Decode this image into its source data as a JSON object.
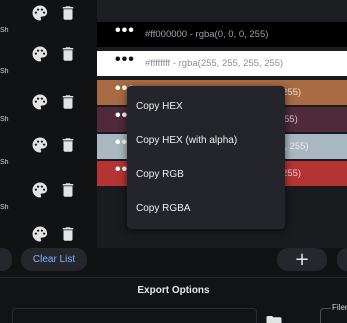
{
  "left_list": {
    "row_label": "Sh",
    "rows": 6
  },
  "buttons": {
    "clear_list": "Clear List",
    "add": "+"
  },
  "swatches": [
    {
      "color": "#000000",
      "text_color": "#9aa0a6",
      "dots_color": "#ffffff",
      "text": "#ff000000 - rgba(0, 0, 0, 255)"
    },
    {
      "color": "#ffffff",
      "text_color": "#8a8f96",
      "dots_color": "#111111",
      "text": "#ffffffff - rgba(255, 255, 255, 255)"
    },
    {
      "color": "#a86b43",
      "text_color": "#f2d9c6",
      "dots_color": "#ffffff",
      "text": "255)"
    },
    {
      "color": "#4e2a3a",
      "text_color": "#d9c4cc",
      "dots_color": "#ffffff",
      "text": "55)"
    },
    {
      "color": "#a9b8c0",
      "text_color": "#e8eef1",
      "dots_color": "#ffffff",
      "text": "3, 255)"
    },
    {
      "color": "#b43434",
      "text_color": "#f4c9c9",
      "dots_color": "#ffffff",
      "text": "255)"
    }
  ],
  "context_menu": {
    "items": [
      "Copy HEX",
      "Copy HEX (with alpha)",
      "Copy RGB",
      "Copy RGBA"
    ]
  },
  "export": {
    "title": "Export Options",
    "filename_label": "Filen"
  },
  "icons": {
    "palette": "palette-icon",
    "trash": "trash-icon",
    "folder": "folder-icon"
  }
}
